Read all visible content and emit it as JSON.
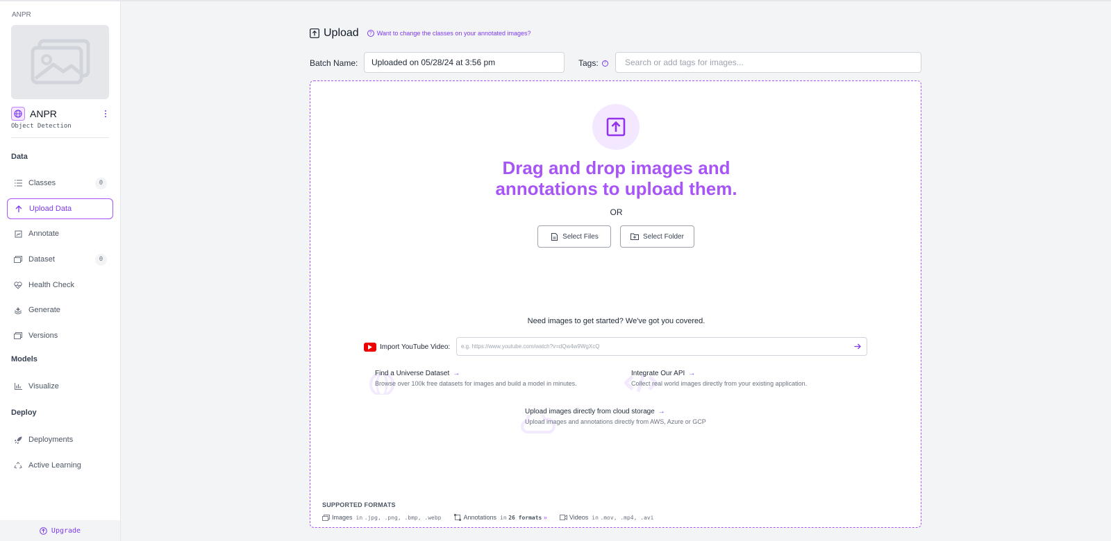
{
  "sidebar": {
    "project_kicker": "ANPR",
    "project_name": "ANPR",
    "project_type": "Object Detection",
    "sections": {
      "data": "Data",
      "models": "Models",
      "deploy": "Deploy"
    },
    "items": [
      {
        "label": "Classes",
        "badge": "0",
        "icon": "list-icon"
      },
      {
        "label": "Upload Data",
        "icon": "arrow-up-icon",
        "active": true
      },
      {
        "label": "Annotate",
        "icon": "annotate-icon"
      },
      {
        "label": "Dataset",
        "badge": "0",
        "icon": "images-icon"
      },
      {
        "label": "Health Check",
        "icon": "heart-pulse-icon"
      },
      {
        "label": "Generate",
        "icon": "sparkle-stack-icon"
      },
      {
        "label": "Versions",
        "icon": "versions-icon"
      },
      {
        "label": "Visualize",
        "icon": "bar-chart-icon"
      },
      {
        "label": "Deployments",
        "icon": "rocket-icon"
      },
      {
        "label": "Active Learning",
        "icon": "recycle-icon"
      }
    ],
    "upgrade_label": "Upgrade"
  },
  "header": {
    "title": "Upload",
    "help_link": "Want to change the classes on your annotated images?"
  },
  "form": {
    "batch_label": "Batch Name:",
    "batch_value": "Uploaded on 05/28/24 at 3:56 pm",
    "tags_label": "Tags:",
    "tags_placeholder": "Search or add tags for images..."
  },
  "dropzone": {
    "heading_line1": "Drag and drop images and",
    "heading_line2": "annotations to upload them.",
    "or": "OR",
    "select_files": "Select Files",
    "select_folder": "Select Folder",
    "need_images": "Need images to get started? We've got you covered.",
    "youtube_label": "Import YouTube Video:",
    "youtube_placeholder": "e.g. https://www.youtube.com/watch?v=dQw4w9WgXcQ",
    "resources": {
      "universe_title": "Find a Universe Dataset",
      "universe_desc": "Browse over 100k free datasets for images and build a model in minutes.",
      "api_title": "Integrate Our API",
      "api_desc": "Collect real world images directly from your existing application.",
      "cloud_title": "Upload images directly from cloud storage",
      "cloud_desc": "Upload images and annotations directly from AWS, Azure or GCP"
    },
    "formats": {
      "heading": "SUPPORTED FORMATS",
      "images_label": "Images",
      "images_in": "in",
      "images_exts": ".jpg, .png, .bmp, .webp",
      "annotations_label": "Annotations",
      "annotations_in": "in",
      "annotations_count": "26 formats",
      "videos_label": "Videos",
      "videos_in": "in",
      "videos_exts": ".mov, .mp4, .avi"
    }
  },
  "colors": {
    "accent": "#a855f7",
    "accent_dark": "#7c3aed",
    "youtube_red": "#ef0000"
  }
}
